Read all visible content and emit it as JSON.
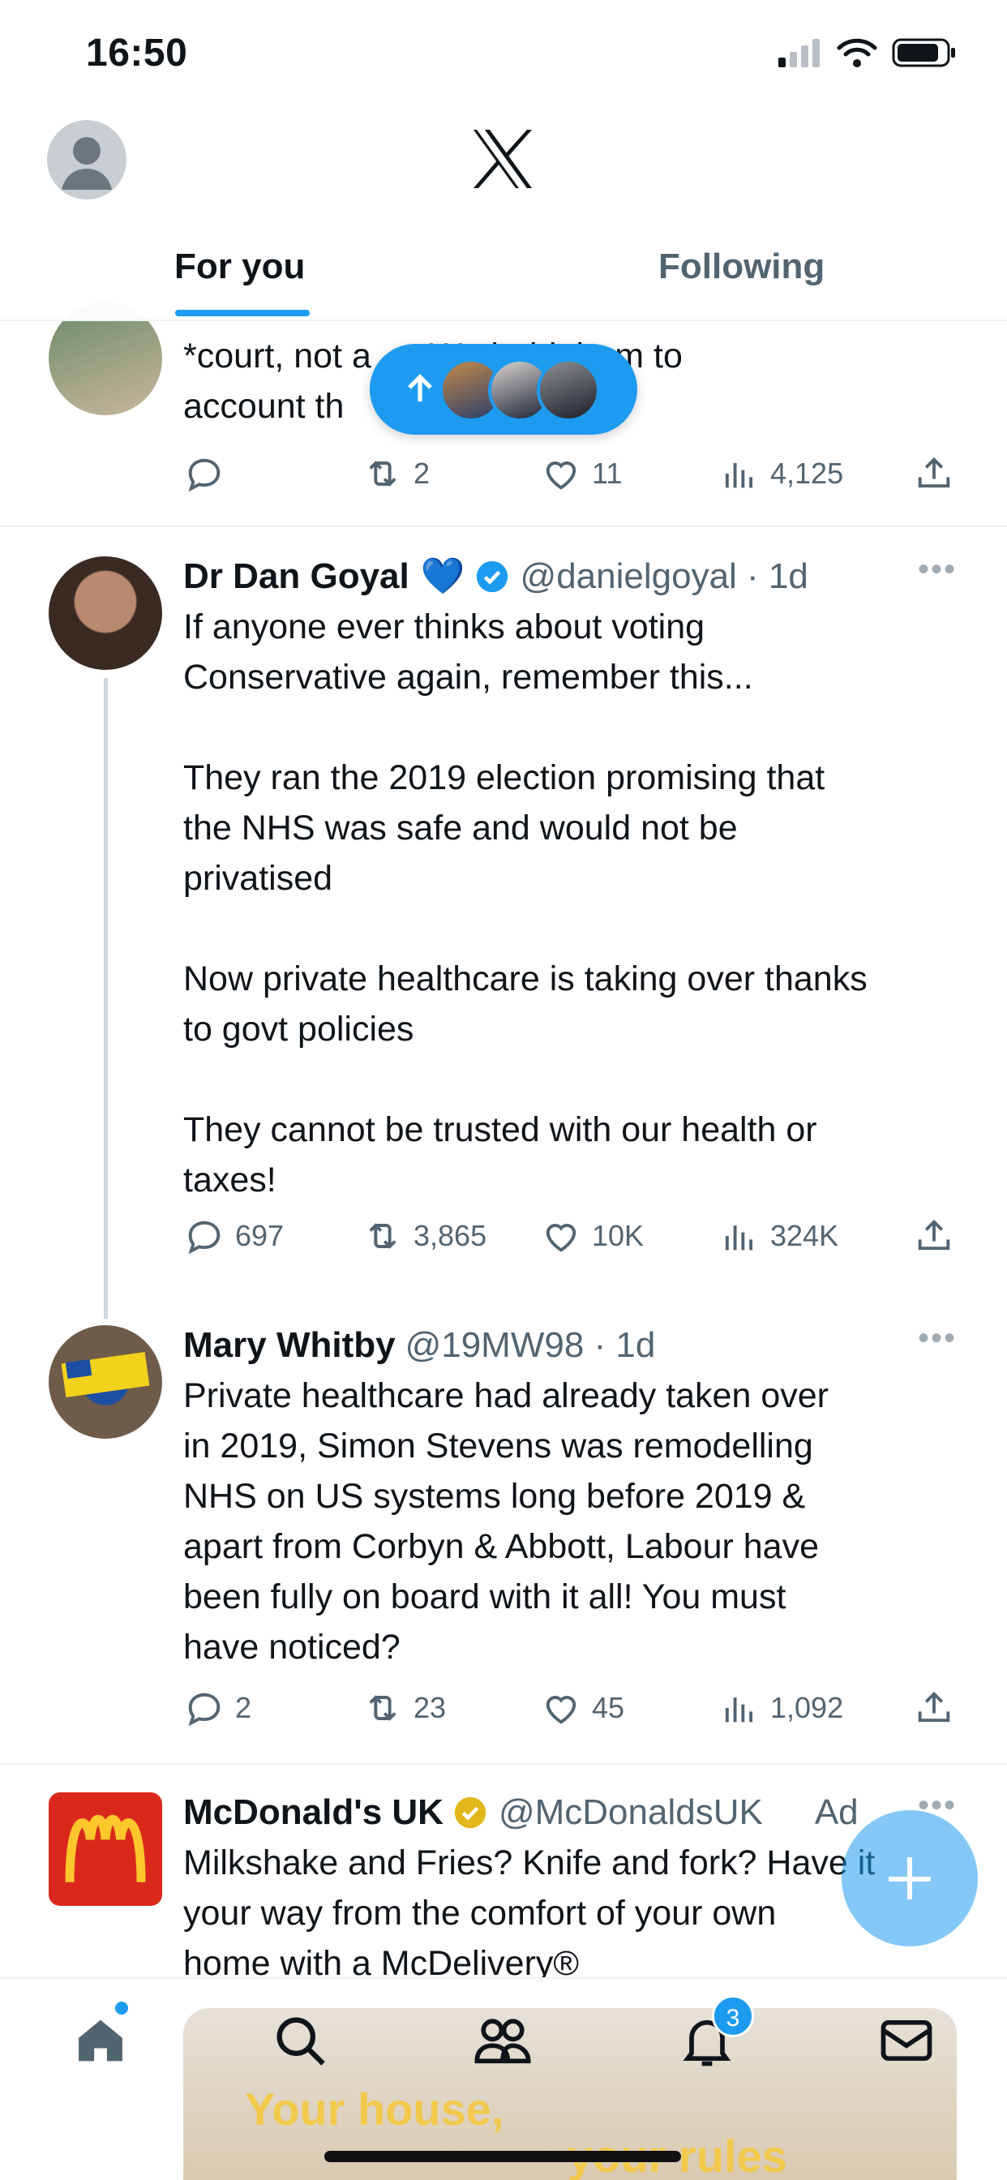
{
  "status": {
    "time": "16:50"
  },
  "tabs": {
    "for_you": "For you",
    "following": "Following"
  },
  "partial_tweet": {
    "text": "*court, not a    . We hold them to\naccount th",
    "replies": "",
    "reposts": "2",
    "likes": "11",
    "views": "4,125"
  },
  "tweets": [
    {
      "name": "Dr Dan Goyal",
      "emoji": "💙",
      "handle": "@danielgoyal · 1d",
      "text": "If anyone ever thinks about voting\nConservative again, remember this...\n\nThey ran the 2019 election promising that\nthe NHS was safe and would not be\nprivatised\n\nNow private healthcare is taking over thanks\nto govt policies\n\nThey cannot be trusted with our health or\ntaxes!",
      "replies": "697",
      "reposts": "3,865",
      "likes": "10K",
      "views": "324K"
    },
    {
      "name": "Mary Whitby",
      "handle": "@19MW98 · 1d",
      "text": "Private healthcare had already taken over\nin 2019, Simon Stevens was remodelling\nNHS on US systems long before 2019 &\napart from Corbyn & Abbott, Labour have\nbeen fully on board with it all! You must\nhave noticed?",
      "replies": "2",
      "reposts": "23",
      "likes": "45",
      "views": "1,092"
    },
    {
      "name": "McDonald's UK",
      "handle": "@McDonaldsUK",
      "ad_label": "Ad",
      "text": "Milkshake and Fries? Knife and fork? Have it\nyour way from the comfort of your own\nhome with a McDelivery®"
    }
  ],
  "bottom_nav": {
    "notification_count": "3"
  },
  "promo": {
    "line1": "Your house,",
    "line2": "your rules"
  },
  "colors": {
    "accent": "#1d9bf0",
    "text": "#0f1419",
    "muted": "#536471",
    "mcd_red": "#da291c",
    "mcd_yellow": "#ffc72c"
  }
}
